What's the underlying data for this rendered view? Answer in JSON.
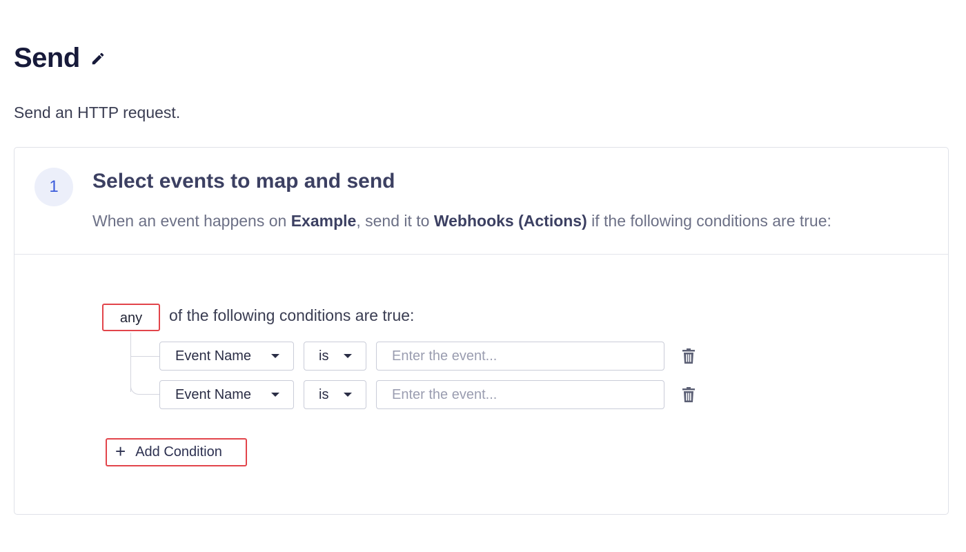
{
  "header": {
    "title": "Send",
    "subtitle": "Send an HTTP request.",
    "edit_icon": "pencil-icon"
  },
  "step": {
    "number": "1",
    "title": "Select events to map and send",
    "desc_prefix": "When an event happens on ",
    "source": "Example",
    "desc_middle": ", send it to ",
    "destination": "Webhooks (Actions)",
    "desc_suffix": " if the following conditions are true:"
  },
  "conditions": {
    "match_mode": "any",
    "intro": "of the following conditions are true:",
    "rows": [
      {
        "field": "Event Name",
        "operator": "is",
        "value": "",
        "placeholder": "Enter the event..."
      },
      {
        "field": "Event Name",
        "operator": "is",
        "value": "",
        "placeholder": "Enter the event..."
      }
    ],
    "delete_icon": "trash-icon",
    "add_label": "Add Condition",
    "add_icon": "plus-icon"
  },
  "colors": {
    "accent": "#3b5bdb",
    "highlight": "#e2444a",
    "title": "#171a3a"
  }
}
